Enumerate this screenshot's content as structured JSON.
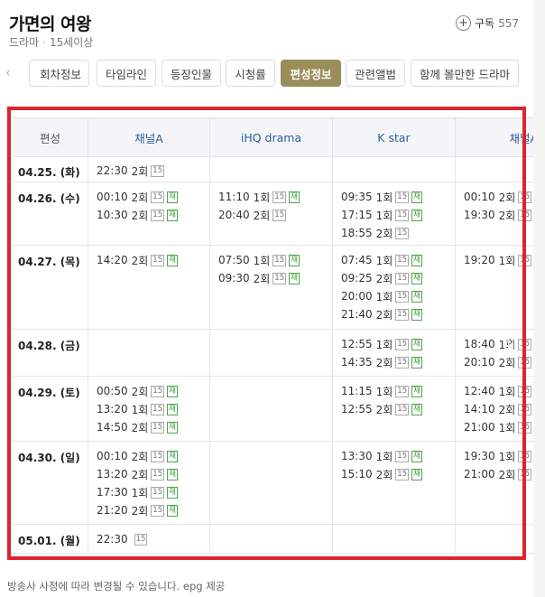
{
  "header": {
    "title": "가면의 여왕",
    "genre": "드라마",
    "rating": "15세이상",
    "subscribe_label": "구독",
    "subscribe_count": "557"
  },
  "tabs": [
    {
      "label": "회차정보"
    },
    {
      "label": "타임라인"
    },
    {
      "label": "등장인물"
    },
    {
      "label": "시청률"
    },
    {
      "label": "편성정보",
      "active": true
    },
    {
      "label": "관련앨범"
    },
    {
      "label": "함께 볼만한 드라마"
    }
  ],
  "schedule": {
    "columns": [
      "편성",
      "채널A",
      "iHQ drama",
      "K star",
      "채널A플러스"
    ],
    "rows": [
      {
        "date": "04.25. (화)",
        "cells": [
          [
            {
              "time": "22:30",
              "ep": "2회",
              "badges": [
                "15"
              ]
            }
          ],
          [],
          [],
          []
        ]
      },
      {
        "date": "04.26. (수)",
        "cells": [
          [
            {
              "time": "00:10",
              "ep": "2회",
              "badges": [
                "15",
                "재"
              ]
            },
            {
              "time": "10:30",
              "ep": "2회",
              "badges": [
                "15",
                "재"
              ]
            }
          ],
          [
            {
              "time": "11:10",
              "ep": "1회",
              "badges": [
                "15",
                "재"
              ]
            },
            {
              "time": "20:40",
              "ep": "2회",
              "badges": [
                "15"
              ]
            }
          ],
          [
            {
              "time": "09:35",
              "ep": "1회",
              "badges": [
                "15",
                "재"
              ]
            },
            {
              "time": "17:15",
              "ep": "1회",
              "badges": [
                "15",
                "재"
              ]
            },
            {
              "time": "18:55",
              "ep": "2회",
              "badges": [
                "15"
              ]
            }
          ],
          [
            {
              "time": "00:10",
              "ep": "2회",
              "badges": [
                "15",
                "재"
              ]
            },
            {
              "time": "19:30",
              "ep": "2회",
              "badges": [
                "15",
                "재"
              ]
            }
          ]
        ]
      },
      {
        "date": "04.27. (목)",
        "cells": [
          [
            {
              "time": "14:20",
              "ep": "2회",
              "badges": [
                "15",
                "재"
              ]
            }
          ],
          [
            {
              "time": "07:50",
              "ep": "1회",
              "badges": [
                "15",
                "재"
              ]
            },
            {
              "time": "09:30",
              "ep": "2회",
              "badges": [
                "15",
                "재"
              ]
            }
          ],
          [
            {
              "time": "07:45",
              "ep": "1회",
              "badges": [
                "15",
                "재"
              ]
            },
            {
              "time": "09:25",
              "ep": "2회",
              "badges": [
                "15",
                "재"
              ]
            },
            {
              "time": "20:00",
              "ep": "1회",
              "badges": [
                "15",
                "재"
              ]
            },
            {
              "time": "21:40",
              "ep": "2회",
              "badges": [
                "15",
                "재"
              ]
            }
          ],
          [
            {
              "time": "19:20",
              "ep": "1회",
              "badges": [
                "15",
                "재"
              ]
            }
          ]
        ]
      },
      {
        "date": "04.28. (금)",
        "cells": [
          [],
          [],
          [
            {
              "time": "12:55",
              "ep": "1회",
              "badges": [
                "15",
                "재"
              ]
            },
            {
              "time": "14:35",
              "ep": "2회",
              "badges": [
                "15",
                "재"
              ]
            }
          ],
          [
            {
              "time": "18:40",
              "ep": "1회",
              "badges": [
                "15",
                "재"
              ]
            },
            {
              "time": "20:10",
              "ep": "2회",
              "badges": [
                "15",
                "재"
              ]
            }
          ]
        ]
      },
      {
        "date": "04.29. (토)",
        "cells": [
          [
            {
              "time": "00:50",
              "ep": "2회",
              "badges": [
                "15",
                "재"
              ]
            },
            {
              "time": "13:20",
              "ep": "1회",
              "badges": [
                "15",
                "재"
              ]
            },
            {
              "time": "14:50",
              "ep": "2회",
              "badges": [
                "15",
                "재"
              ]
            }
          ],
          [],
          [
            {
              "time": "11:15",
              "ep": "1회",
              "badges": [
                "15",
                "재"
              ]
            },
            {
              "time": "12:55",
              "ep": "2회",
              "badges": [
                "15",
                "재"
              ]
            }
          ],
          [
            {
              "time": "12:40",
              "ep": "1회",
              "badges": [
                "15",
                "재"
              ]
            },
            {
              "time": "14:10",
              "ep": "2회",
              "badges": [
                "15",
                "재"
              ]
            },
            {
              "time": "21:00",
              "ep": "1회",
              "badges": [
                "15",
                "재"
              ]
            }
          ]
        ]
      },
      {
        "date": "04.30. (일)",
        "cells": [
          [
            {
              "time": "00:10",
              "ep": "2회",
              "badges": [
                "15",
                "재"
              ]
            },
            {
              "time": "13:20",
              "ep": "2회",
              "badges": [
                "15",
                "재"
              ]
            },
            {
              "time": "17:30",
              "ep": "1회",
              "badges": [
                "15",
                "재"
              ]
            },
            {
              "time": "21:20",
              "ep": "2회",
              "badges": [
                "15",
                "재"
              ]
            }
          ],
          [],
          [
            {
              "time": "13:30",
              "ep": "1회",
              "badges": [
                "15",
                "재"
              ]
            },
            {
              "time": "15:10",
              "ep": "2회",
              "badges": [
                "15",
                "재"
              ]
            }
          ],
          [
            {
              "time": "19:30",
              "ep": "1회",
              "badges": [
                "15",
                "재"
              ]
            },
            {
              "time": "21:00",
              "ep": "2회",
              "badges": [
                "15",
                "재"
              ]
            }
          ]
        ]
      },
      {
        "date": "05.01. (월)",
        "cells": [
          [
            {
              "time": "22:30",
              "ep": "",
              "badges": [
                "15"
              ]
            }
          ],
          [],
          [],
          []
        ]
      }
    ]
  },
  "footer": {
    "note": "방송사 사정에 따라 변경될 수 있습니다. epg 제공"
  },
  "colors": {
    "active_tab": "#9a8d5a",
    "highlight_border": "#e0232d",
    "rerun_badge": "#3c9a3c",
    "channel_header": "#2d5da1"
  }
}
